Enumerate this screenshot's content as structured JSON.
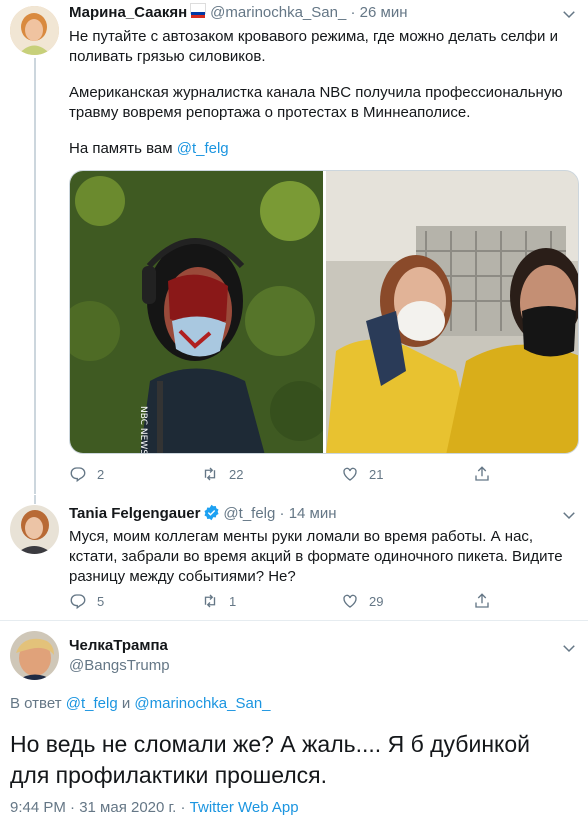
{
  "tweet1": {
    "author_name": "Марина_Саакян",
    "handle": "@marinochka_San_",
    "separator": "·",
    "time": "26 мин",
    "para1": "Не путайте с автозаком кровавого режима, где можно делать селфи и поливать грязью силовиков.",
    "para2": "Американская журналистка канала NBC получила профессиональную травму вовремя репортажа о протестах в Миннеаполисе.",
    "para3_prefix": "На память вам ",
    "para3_mention": "@t_felg",
    "photo1_caption": "NBC NEWS",
    "reply_count": "2",
    "retweet_count": "22",
    "like_count": "21"
  },
  "tweet2": {
    "author_name": "Tania Felgengauer",
    "handle": "@t_felg",
    "separator": "·",
    "time": "14 мин",
    "text": "Муся, моим коллегам менты руки ломали во время работы. А нас, кстати, забрали во время акций в формате одиночного пикета. Видите разницу между событиями? Не?",
    "reply_count": "5",
    "retweet_count": "1",
    "like_count": "29"
  },
  "tweet3": {
    "author_name": "ЧелкаТрампа",
    "handle": "@BangsTrump",
    "reply_prefix": "В ответ ",
    "reply_mention1": "@t_felg",
    "reply_and": " и ",
    "reply_mention2": "@marinochka_San_",
    "text": "Но ведь не сломали же? А жаль.... Я б дубинкой для профилактики прошелся.",
    "timestamp": "9:44 PM · 31 мая 2020 г. · ",
    "source": "Twitter Web App"
  },
  "colors": {
    "accent": "#1b95e0",
    "muted": "#657786",
    "text": "#14171a",
    "divider": "#e6ecf0"
  },
  "icons": [
    "reply-icon",
    "retweet-icon",
    "like-icon",
    "share-icon",
    "verified-icon",
    "chevron-down-icon",
    "russia-flag-icon"
  ]
}
